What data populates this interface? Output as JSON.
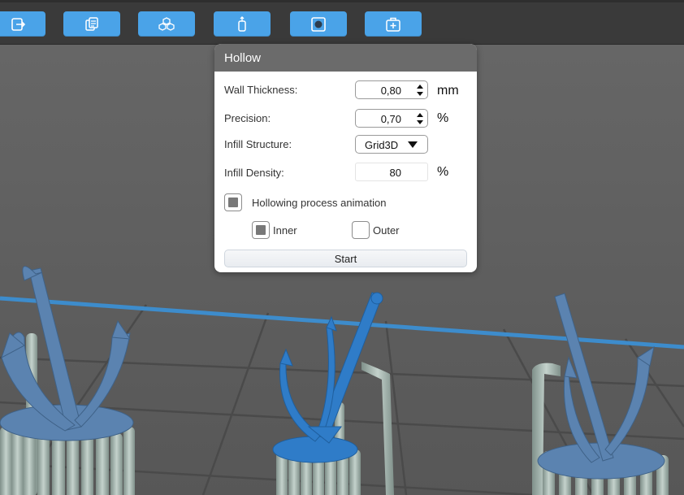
{
  "toolbar": {
    "buttons": [
      {
        "icon": "export-icon"
      },
      {
        "icon": "copy-icon"
      },
      {
        "icon": "arrange-icon"
      },
      {
        "icon": "orient-icon"
      },
      {
        "icon": "hollow-icon"
      },
      {
        "icon": "add-supports-icon"
      }
    ],
    "accent": "#4aa3e8"
  },
  "dialog": {
    "title": "Hollow",
    "wall_thickness": {
      "label": "Wall Thickness:",
      "value": "0,80",
      "unit": "mm"
    },
    "precision": {
      "label": "Precision:",
      "value": "0,70",
      "unit": "%"
    },
    "infill_structure": {
      "label": "Infill Structure:",
      "value": "Grid3D"
    },
    "infill_density": {
      "label": "Infill Density:",
      "value": "80",
      "unit": "%"
    },
    "animation": {
      "label": "Hollowing process animation",
      "checked": true
    },
    "inner": {
      "label": "Inner",
      "checked": true
    },
    "outer": {
      "label": "Outer",
      "checked": false
    },
    "start_label": "Start"
  },
  "colors": {
    "model": "#5b83b0",
    "model_selected": "#2f7cc8",
    "support": "#a3b5ae",
    "build_plate_edge": "#3d8ccc"
  }
}
